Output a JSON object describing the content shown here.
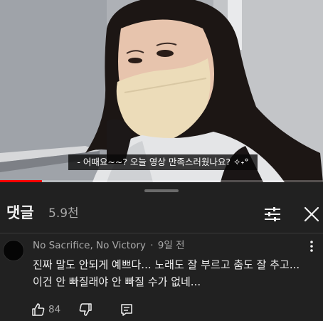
{
  "video": {
    "subtitle": "- 어때요~~? 오늘 영상 만족스러웠나요? ✧˖°",
    "progress": 0.13,
    "progress_color": "#ff0000"
  },
  "comments_sheet": {
    "title": "댓글",
    "count": "5.9천",
    "filter_icon": "sliders-icon",
    "close_icon": "close-icon"
  },
  "comment": {
    "author": "No Sacrifice, No Victory",
    "separator": "·",
    "time": "9일 전",
    "text": "진짜 말도 안되게 예쁘다... 노래도 잘 부르고 춤도 잘 추고... 이건 안 빠질래야 안 빠질 수가 없네...",
    "like_count": "84",
    "icons": [
      "thumbs-up-icon",
      "thumbs-down-icon",
      "reply-icon",
      "more-vert-icon"
    ]
  }
}
